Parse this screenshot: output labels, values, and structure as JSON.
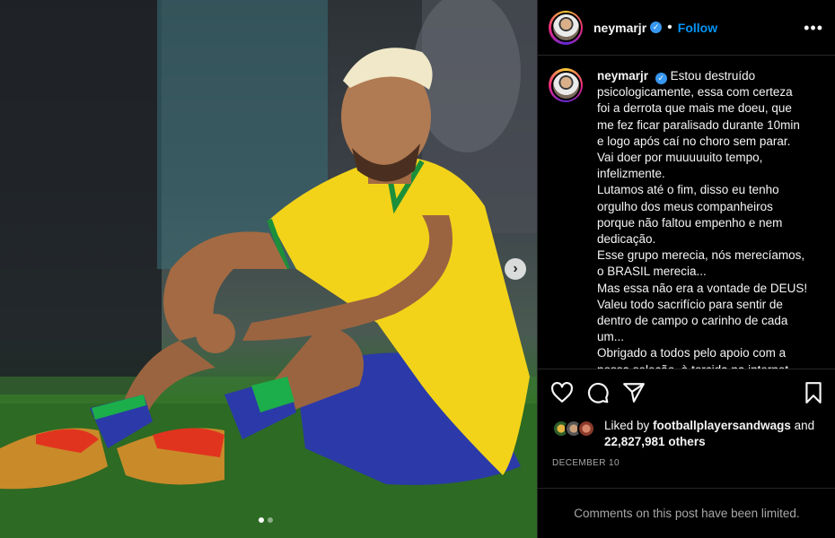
{
  "post": {
    "username": "neymarjr",
    "verified_glyph": "✓",
    "separator": "•",
    "follow_label": "Follow",
    "more_label": "•••",
    "next_glyph": "›",
    "caption_lines": "Estou destruído\npsicologicamente, essa com certeza\nfoi a derrota que mais me doeu, que\nme fez ficar paralisado durante 10min\ne logo após caí no choro sem parar.\nVai doer por muuuuuito tempo,\ninfelizmente.\nLutamos até o fim, disso eu tenho\norgulho dos meus companheiros\nporque não faltou empenho e nem\ndedicação.\nEsse grupo merecia, nós merecíamos,\no BRASIL merecia...\nMas essa não era a vontade de DEUS!\nValeu todo sacrifício para sentir de\ndentro de campo o carinho de cada\num...\nObrigado a todos pelo apoio com a\nnossa seleção, à torcida na internet"
  },
  "likes": {
    "prefix": "Liked by",
    "liked_by_user": "footballplayersandwags",
    "and": "and",
    "count": "22,827,981 others"
  },
  "date": "DECEMBER 10",
  "comments_limited": "Comments on this post have been limited.",
  "carousel": {
    "total": 2,
    "current": 1
  },
  "icons": [
    "heart-icon",
    "comment-icon",
    "share-icon",
    "bookmark-icon",
    "more-icon",
    "chevron-right-icon",
    "verified-badge-icon"
  ],
  "colors": {
    "link": "#0095f6",
    "verified": "#3897f0",
    "jersey": "#f2d31a",
    "grass": "#2f6a2c",
    "shorts": "#2b3aa8"
  }
}
